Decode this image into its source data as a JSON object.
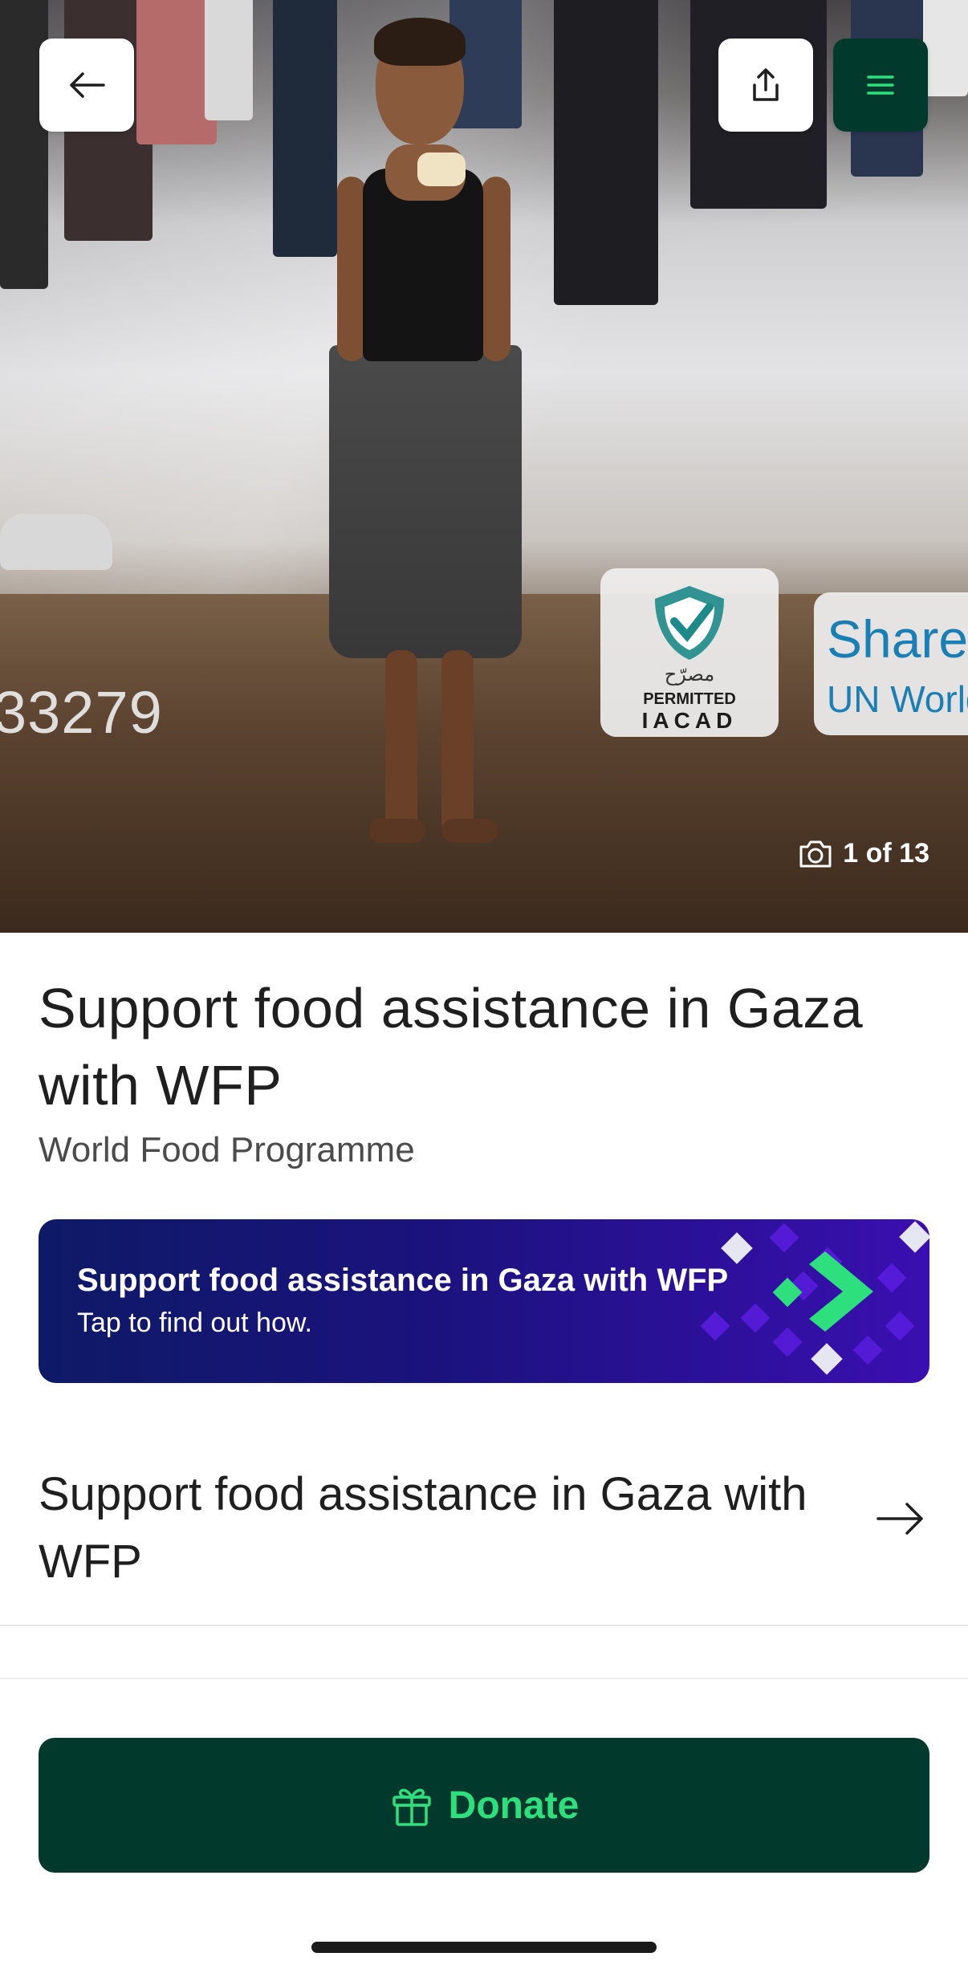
{
  "hero": {
    "photo_counter": "1 of 13",
    "overlay_number": "33279",
    "watermark_arabic": "مصرّح",
    "watermark_permitted": "PERMITTED",
    "watermark_iacad": "IACAD",
    "watermark_share": "Share",
    "watermark_un": "UN World"
  },
  "header": {
    "back_icon": "arrow-left-icon",
    "share_icon": "share-icon",
    "menu_icon": "hamburger-menu-icon"
  },
  "campaign": {
    "title": "Support food assistance in Gaza with WFP",
    "organization": "World Food Programme"
  },
  "banner": {
    "title": "Support food assistance in Gaza with WFP",
    "subtitle": "Tap to find out how."
  },
  "link_row": {
    "label": "Support food assistance in Gaza with WFP",
    "icon": "arrow-right-icon"
  },
  "donate": {
    "label": "Donate",
    "icon": "gift-icon"
  },
  "colors": {
    "primary_dark": "#013a2c",
    "accent_green": "#2ee07d",
    "banner_start": "#0e1a66",
    "banner_end": "#3a0fb0"
  }
}
